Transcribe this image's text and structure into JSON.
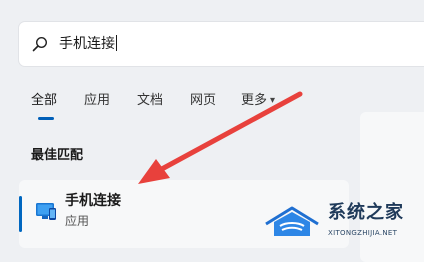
{
  "search": {
    "query": "手机连接"
  },
  "tabs": [
    {
      "label": "全部"
    },
    {
      "label": "应用"
    },
    {
      "label": "文档"
    },
    {
      "label": "网页"
    },
    {
      "label": "更多"
    }
  ],
  "best_match": {
    "section_title": "最佳匹配",
    "result_name": "手机连接",
    "result_type": "应用",
    "icon": "phone-link-app-icon"
  },
  "watermark": {
    "title": "系统之家",
    "url": "XITONGZHIJIA.NET"
  },
  "colors": {
    "accent": "#005fb8",
    "annotation_arrow": "#e8413c"
  }
}
